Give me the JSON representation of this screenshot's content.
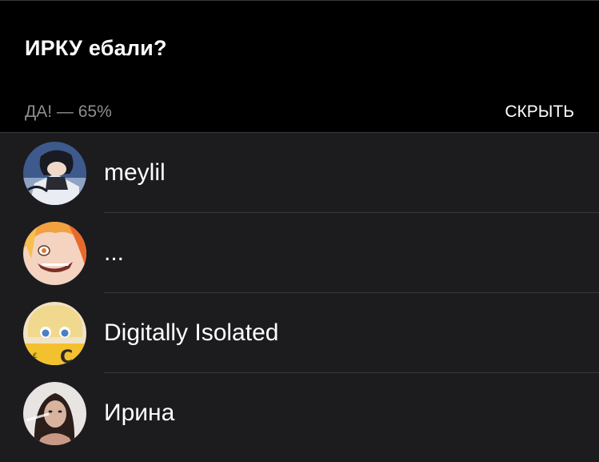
{
  "poll": {
    "question": "ИРКУ ебали?",
    "option_label": "ДА! — 65%",
    "hide_label": "СКРЫТЬ"
  },
  "voters": [
    {
      "name": "meylil",
      "avatar": "anime-boy-avatar"
    },
    {
      "name": "...",
      "avatar": "anime-girl-orange-avatar"
    },
    {
      "name": "Digitally Isolated",
      "avatar": "anime-girl-blonde-avatar"
    },
    {
      "name": "Ирина",
      "avatar": "photo-woman-avatar"
    }
  ],
  "colors": {
    "background": "#000000",
    "list_background": "#1c1c1e",
    "secondary_text": "#8e8e93",
    "divider": "#38383a"
  }
}
